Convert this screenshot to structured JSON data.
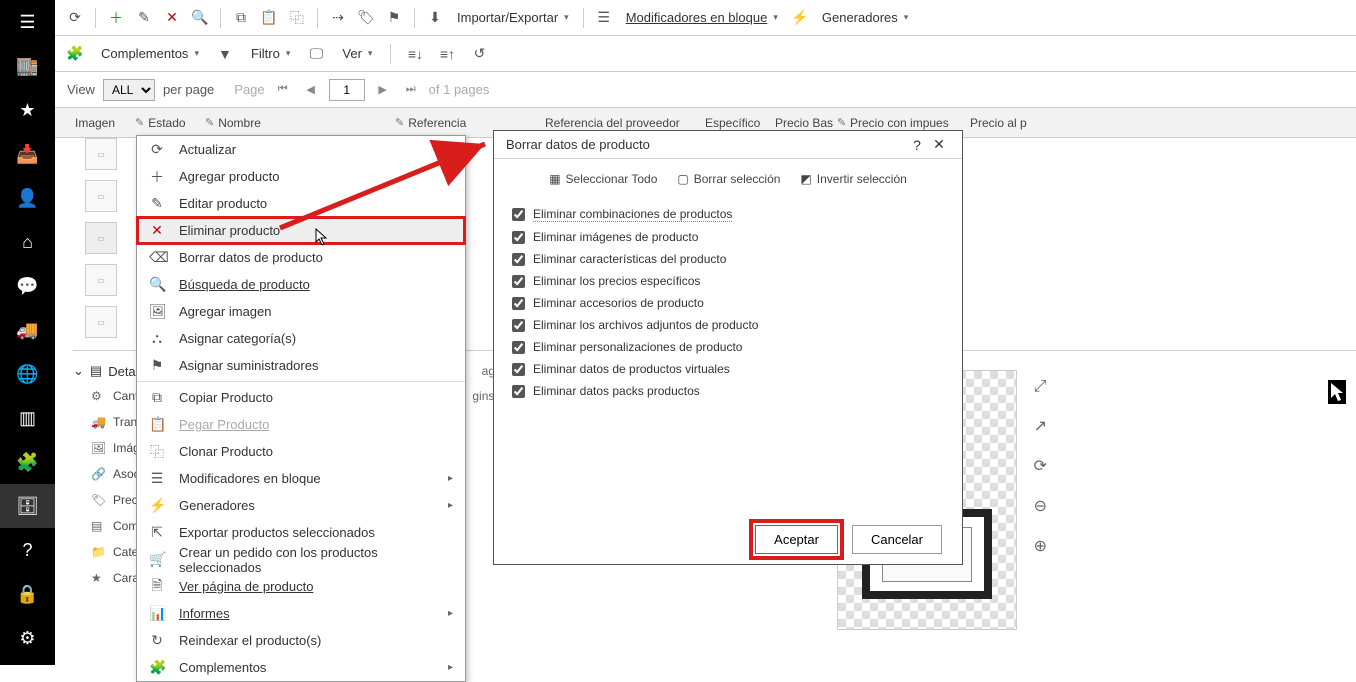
{
  "sidebar": {
    "items": [
      "menu",
      "store",
      "star",
      "inbox",
      "user",
      "home",
      "chat",
      "truck",
      "globe",
      "chart",
      "puzzle",
      "archive",
      "help",
      "lock",
      "gear"
    ]
  },
  "toolbar1": {
    "importExport": "Importar/Exportar",
    "bulkMods": "Modificadores en bloque",
    "generators": "Generadores"
  },
  "toolbar2": {
    "addons": "Complementos",
    "filter": "Filtro",
    "view": "Ver"
  },
  "pager": {
    "viewLabel": "View",
    "allOption": "ALL",
    "perPage": "per page",
    "pageLabel": "Page",
    "pageNum": "1",
    "ofPages": "of 1 pages"
  },
  "grid": {
    "image": "Imagen",
    "state": "Estado",
    "name": "Nombre",
    "reference": "Referencia",
    "supplierRef": "Referencia del proveedor",
    "specific": "Específico",
    "basePrice": "Precio Bas",
    "priceTax": "Precio con impues",
    "priceAt": "Precio al p"
  },
  "contextMenu": {
    "refresh": "Actualizar",
    "addProduct": "Agregar producto",
    "editProduct": "Editar producto",
    "deleteProduct": "Eliminar producto",
    "eraseData": "Borrar datos de producto",
    "searchProduct": "Búsqueda de producto",
    "addImage": "Agregar imagen",
    "assignCategory": "Asignar categoría(s)",
    "assignSuppliers": "Asignar suministradores",
    "copyProduct": "Copiar Producto",
    "pasteProduct": "Pegar Producto",
    "cloneProduct": "Clonar Producto",
    "bulkMods": "Modificadores en bloque",
    "generators": "Generadores",
    "exportSelected": "Exportar productos seleccionados",
    "createOrder": "Crear un pedido con los productos seleccionados",
    "viewProductPage": "Ver página de producto",
    "reports": "Informes",
    "reindex": "Reindexar el producto(s)",
    "addons": "Complementos"
  },
  "dialog": {
    "title": "Borrar datos de producto",
    "help": "?",
    "selectAll": "Seleccionar Todo",
    "clearSelection": "Borrar selección",
    "invertSelection": "Invertir selección",
    "options": [
      "Eliminar combinaciones de productos",
      "Eliminar imágenes de producto",
      "Eliminar características del producto",
      "Eliminar los precios específicos",
      "Eliminar accesorios de producto",
      "Eliminar los archivos adjuntos de producto",
      "Eliminar personalizaciones de producto",
      "Eliminar datos de productos virtuales",
      "Eliminar datos packs productos"
    ],
    "accept": "Aceptar",
    "cancel": "Cancelar"
  },
  "detail": {
    "header": "Deta",
    "items": [
      "Cant",
      "Tran",
      "Imág",
      "Asoc",
      "Preci",
      "Com",
      "Cate",
      "Cara"
    ],
    "extra1": "agen",
    "extra2": "gins"
  }
}
